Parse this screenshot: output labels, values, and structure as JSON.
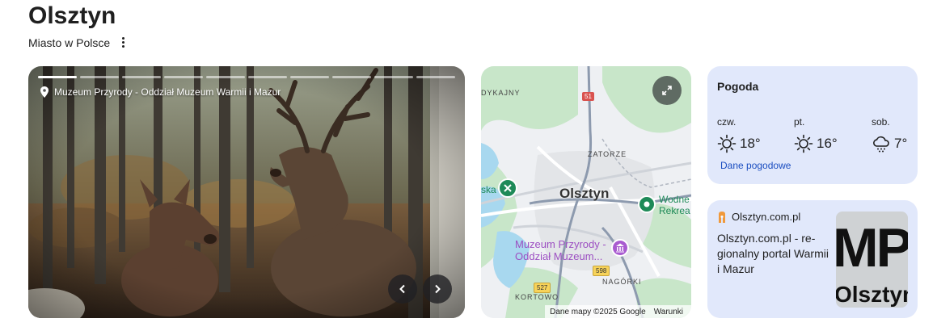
{
  "header": {
    "title": "Olsztyn",
    "subtitle": "Miasto w Polsce"
  },
  "photo": {
    "caption": "Muzeum Przyrody - Oddział Muzeum Warmii i Mazur",
    "slide_count": 10,
    "active_slide": 1
  },
  "map": {
    "labels": {
      "dykajny": "DYKAJNY",
      "zatorze": "ZATORZE",
      "city": "Olsztyn",
      "ska": "ska",
      "wodne": "Wodne",
      "rekrea": "Rekrea",
      "museum_line1": "Muzeum Przyrody -",
      "museum_line2": "Oddział Muzeum...",
      "nagorki": "NAGÓRKI",
      "kortowo": "KORTOWO",
      "road_51": "51",
      "road_598": "598",
      "road_527": "527"
    },
    "attribution": "Dane mapy ©2025 Google",
    "terms": "Warunki"
  },
  "weather": {
    "title": "Pogoda",
    "days": [
      {
        "name": "czw.",
        "temp": "18°",
        "icon": "sunny-icon"
      },
      {
        "name": "pt.",
        "temp": "16°",
        "icon": "sunny-icon"
      },
      {
        "name": "sob.",
        "temp": "7°",
        "icon": "snow-cloud-icon"
      }
    ],
    "link": "Dane pogodowe"
  },
  "news": {
    "source": "Olsztyn.com.pl",
    "text": "Olsztyn.com.pl - re­gionalny portal War­mii i Mazur",
    "thumb_big": "MP",
    "thumb_small": "Olsztyn"
  }
}
